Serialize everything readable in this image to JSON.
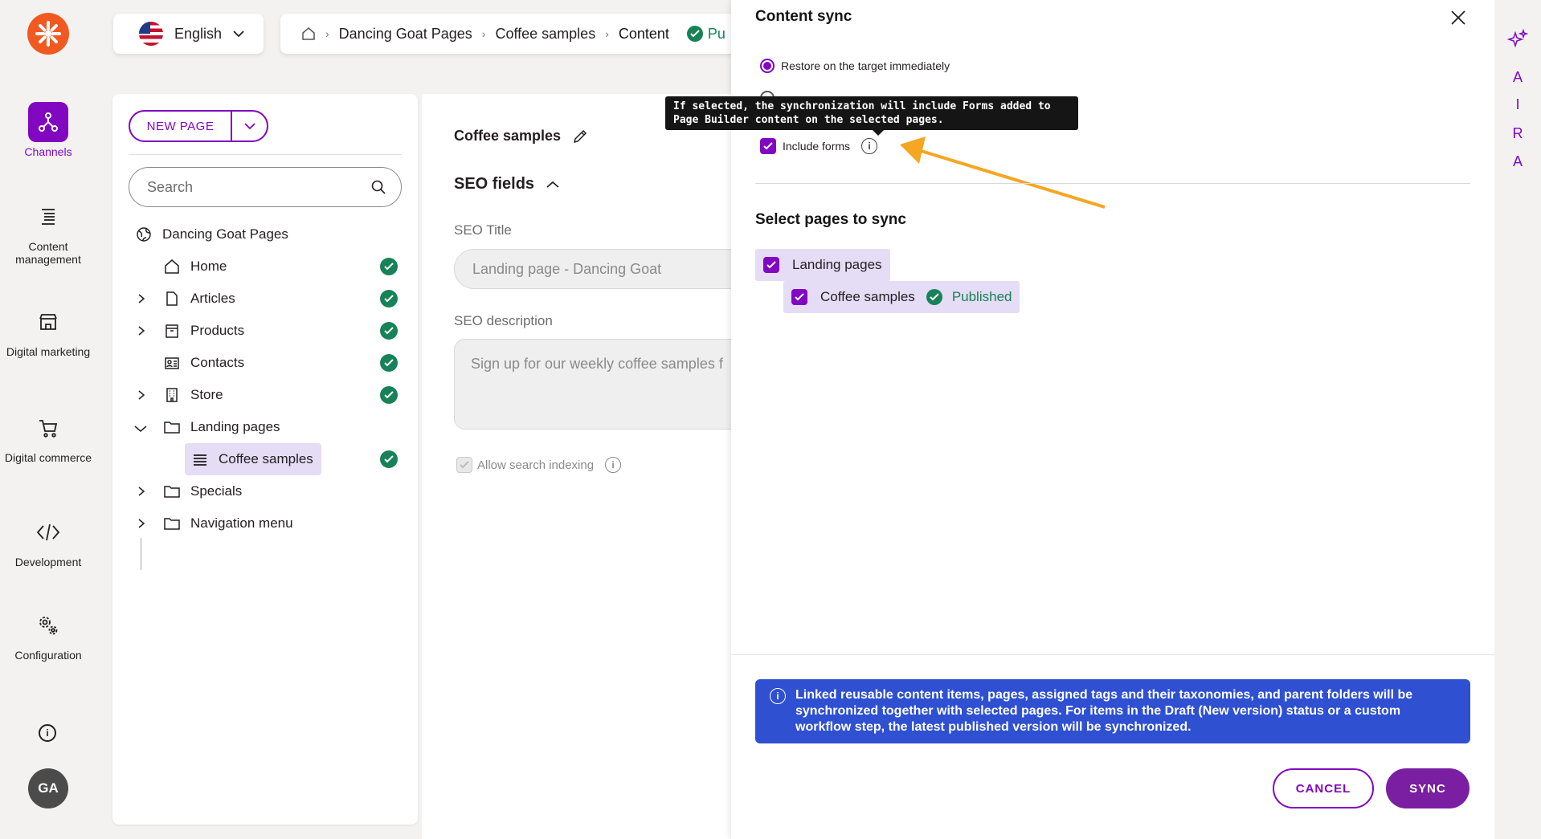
{
  "nav": {
    "items": [
      {
        "label": "Channels",
        "icon": "channels-icon"
      },
      {
        "label": "Content management",
        "icon": "content-management-icon"
      },
      {
        "label": "Digital marketing",
        "icon": "storefront-icon"
      },
      {
        "label": "Digital commerce",
        "icon": "cart-icon"
      },
      {
        "label": "Development",
        "icon": "code-icon"
      },
      {
        "label": "Configuration",
        "icon": "gears-icon"
      }
    ],
    "avatar": "GA"
  },
  "language": {
    "label": "English"
  },
  "breadcrumb": {
    "items": [
      "Dancing Goat Pages",
      "Coffee samples",
      "Content"
    ],
    "status": "Pu"
  },
  "tree": {
    "new_page_label": "NEW PAGE",
    "search_placeholder": "Search",
    "root": "Dancing Goat Pages",
    "items": [
      {
        "label": "Home"
      },
      {
        "label": "Articles"
      },
      {
        "label": "Products"
      },
      {
        "label": "Contacts"
      },
      {
        "label": "Store"
      },
      {
        "label": "Landing pages"
      },
      {
        "label": "Coffee samples"
      },
      {
        "label": "Specials"
      },
      {
        "label": "Navigation menu"
      }
    ]
  },
  "content": {
    "title": "Coffee samples",
    "section": "SEO fields",
    "seo_title_label": "SEO Title",
    "seo_title_value": "Landing page - Dancing Goat",
    "seo_desc_label": "SEO description",
    "seo_desc_value": "Sign up for our weekly coffee samples f",
    "allow_label": "Allow search indexing"
  },
  "dialog": {
    "title": "Content sync",
    "radio_1": "Restore on the target immediately",
    "tooltip": "If selected, the synchronization will include Forms added to Page Builder content on the selected pages.",
    "include_forms": "Include forms",
    "select_title": "Select pages to sync",
    "pages": [
      {
        "label": "Landing pages"
      },
      {
        "label": "Coffee samples",
        "status": "Published"
      }
    ],
    "notice": "Linked reusable content items, pages, assigned tags and their taxonomies, and parent folders will be synchronized together with selected pages. For items in the Draft (New version) status or a custom workflow step, the latest published version will be synchronized.",
    "cancel_label": "CANCEL",
    "sync_label": "SYNC"
  },
  "rightrail": {
    "letters": [
      "A",
      "I",
      "R",
      "A"
    ]
  },
  "colors": {
    "brand": "#8107c1",
    "published": "#178257",
    "notice": "#2e50d1",
    "annotation": "#f5a623"
  }
}
